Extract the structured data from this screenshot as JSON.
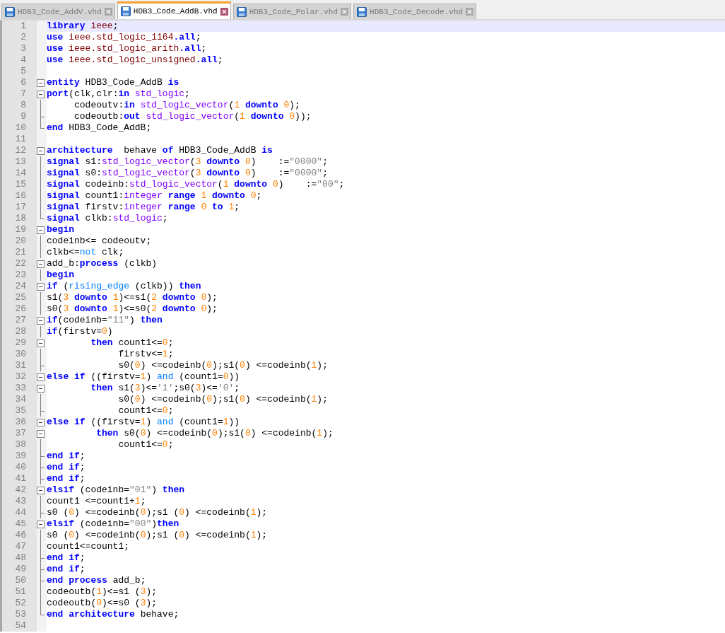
{
  "tabs": [
    {
      "label": "HDB3_Code_AddV.vhd",
      "selected": false
    },
    {
      "label": "HDB3_Code_AddB.vhd",
      "selected": true
    },
    {
      "label": "HDB3_Code_Polar.vhd",
      "selected": false
    },
    {
      "label": "HDB3_Code_Decode.vhd",
      "selected": false
    }
  ],
  "lines": [
    {
      "number": "1",
      "selected": true,
      "segments": [
        {
          "kind": "keyword",
          "text": "library"
        },
        {
          "kind": "library",
          "text": " ieee"
        },
        {
          "kind": "plain",
          "text": ";"
        }
      ]
    },
    {
      "number": "2",
      "selected": false,
      "segments": [
        {
          "kind": "keyword",
          "text": "use"
        },
        {
          "kind": "library",
          "text": " ieee.std_logic_1164"
        },
        {
          "kind": "keyword",
          "text": ".all"
        },
        {
          "kind": "plain",
          "text": ";"
        }
      ]
    },
    {
      "number": "3",
      "selected": false,
      "segments": [
        {
          "kind": "keyword",
          "text": "use"
        },
        {
          "kind": "library",
          "text": " ieee.std_logic_arith"
        },
        {
          "kind": "keyword",
          "text": ".all"
        },
        {
          "kind": "plain",
          "text": ";"
        }
      ]
    },
    {
      "number": "4",
      "selected": false,
      "segments": [
        {
          "kind": "keyword",
          "text": "use"
        },
        {
          "kind": "library",
          "text": " ieee.std_logic_unsigned"
        },
        {
          "kind": "keyword",
          "text": ".all"
        },
        {
          "kind": "plain",
          "text": ";"
        }
      ]
    },
    {
      "number": "5",
      "selected": false
    },
    {
      "number": "6",
      "selected": false,
      "kind": "start",
      "segments": [
        {
          "kind": "keyword",
          "text": "entity"
        },
        {
          "kind": "plain",
          "text": " HDB3_Code_AddB "
        },
        {
          "kind": "keyword",
          "text": "is"
        }
      ]
    },
    {
      "number": "7",
      "selected": false,
      "kind": "start",
      "segments": [
        {
          "kind": "keyword",
          "text": "port"
        },
        {
          "kind": "plain",
          "text": "(clk,clr:"
        },
        {
          "kind": "keyword",
          "text": "in"
        },
        {
          "kind": "type",
          "text": " std_logic"
        },
        {
          "kind": "plain",
          "text": ";"
        }
      ]
    },
    {
      "number": "8",
      "selected": false,
      "kind": "body",
      "segments": [
        {
          "kind": "plain",
          "text": "     codeoutv:"
        },
        {
          "kind": "keyword",
          "text": "in"
        },
        {
          "kind": "type",
          "text": " std_logic_vector"
        },
        {
          "kind": "plain",
          "text": "("
        },
        {
          "kind": "number",
          "text": "1"
        },
        {
          "kind": "keyword",
          "text": " downto"
        },
        {
          "kind": "number",
          "text": " 0"
        },
        {
          "kind": "plain",
          "text": ");"
        }
      ]
    },
    {
      "number": "9",
      "selected": false,
      "kind": "branch",
      "segments": [
        {
          "kind": "plain",
          "text": "     codeoutb:"
        },
        {
          "kind": "keyword",
          "text": "out"
        },
        {
          "kind": "type",
          "text": " std_logic_vector"
        },
        {
          "kind": "plain",
          "text": "("
        },
        {
          "kind": "number",
          "text": "1"
        },
        {
          "kind": "keyword",
          "text": " downto"
        },
        {
          "kind": "number",
          "text": " 0"
        },
        {
          "kind": "plain",
          "text": "));"
        }
      ]
    },
    {
      "number": "10",
      "selected": false,
      "kind": "end",
      "segments": [
        {
          "kind": "keyword",
          "text": "end"
        },
        {
          "kind": "plain",
          "text": " HDB3_Code_AddB;"
        }
      ]
    },
    {
      "number": "11",
      "selected": false
    },
    {
      "number": "12",
      "selected": false,
      "kind": "start",
      "segments": [
        {
          "kind": "keyword",
          "text": "architecture"
        },
        {
          "kind": "plain",
          "text": "  behave "
        },
        {
          "kind": "keyword",
          "text": "of"
        },
        {
          "kind": "plain",
          "text": " HDB3_Code_AddB "
        },
        {
          "kind": "keyword",
          "text": "is"
        }
      ]
    },
    {
      "number": "13",
      "selected": false,
      "kind": "body",
      "segments": [
        {
          "kind": "keyword",
          "text": "signal"
        },
        {
          "kind": "plain",
          "text": " s1:"
        },
        {
          "kind": "type",
          "text": "std_logic_vector"
        },
        {
          "kind": "plain",
          "text": "("
        },
        {
          "kind": "number",
          "text": "3"
        },
        {
          "kind": "keyword",
          "text": " downto"
        },
        {
          "kind": "number",
          "text": " 0"
        },
        {
          "kind": "plain",
          "text": ")    :="
        },
        {
          "kind": "string",
          "text": "\"0000\""
        },
        {
          "kind": "plain",
          "text": ";"
        }
      ]
    },
    {
      "number": "14",
      "selected": false,
      "kind": "body",
      "segments": [
        {
          "kind": "keyword",
          "text": "signal"
        },
        {
          "kind": "plain",
          "text": " s0:"
        },
        {
          "kind": "type",
          "text": "std_logic_vector"
        },
        {
          "kind": "plain",
          "text": "("
        },
        {
          "kind": "number",
          "text": "3"
        },
        {
          "kind": "keyword",
          "text": " downto"
        },
        {
          "kind": "number",
          "text": " 0"
        },
        {
          "kind": "plain",
          "text": ")    :="
        },
        {
          "kind": "string",
          "text": "\"0000\""
        },
        {
          "kind": "plain",
          "text": ";"
        }
      ]
    },
    {
      "number": "15",
      "selected": false,
      "kind": "body",
      "segments": [
        {
          "kind": "keyword",
          "text": "signal"
        },
        {
          "kind": "plain",
          "text": " codeinb:"
        },
        {
          "kind": "type",
          "text": "std_logic_vector"
        },
        {
          "kind": "plain",
          "text": "("
        },
        {
          "kind": "number",
          "text": "1"
        },
        {
          "kind": "keyword",
          "text": " downto"
        },
        {
          "kind": "number",
          "text": " 0"
        },
        {
          "kind": "plain",
          "text": ")    :="
        },
        {
          "kind": "string",
          "text": "\"00\""
        },
        {
          "kind": "plain",
          "text": ";"
        }
      ]
    },
    {
      "number": "16",
      "selected": false,
      "kind": "body",
      "segments": [
        {
          "kind": "keyword",
          "text": "signal"
        },
        {
          "kind": "plain",
          "text": " count1:"
        },
        {
          "kind": "type",
          "text": "integer"
        },
        {
          "kind": "keyword",
          "text": " range"
        },
        {
          "kind": "number",
          "text": " 1"
        },
        {
          "kind": "keyword",
          "text": " downto"
        },
        {
          "kind": "number",
          "text": " 0"
        },
        {
          "kind": "plain",
          "text": ";"
        }
      ]
    },
    {
      "number": "17",
      "selected": false,
      "kind": "body",
      "segments": [
        {
          "kind": "keyword",
          "text": "signal"
        },
        {
          "kind": "plain",
          "text": " firstv:"
        },
        {
          "kind": "type",
          "text": "integer"
        },
        {
          "kind": "keyword",
          "text": " range"
        },
        {
          "kind": "number",
          "text": " 0"
        },
        {
          "kind": "keyword",
          "text": " to"
        },
        {
          "kind": "number",
          "text": " 1"
        },
        {
          "kind": "plain",
          "text": ";"
        }
      ]
    },
    {
      "number": "18",
      "selected": false,
      "kind": "end",
      "segments": [
        {
          "kind": "keyword",
          "text": "signal"
        },
        {
          "kind": "plain",
          "text": " clkb:"
        },
        {
          "kind": "type",
          "text": "std_logic"
        },
        {
          "kind": "plain",
          "text": ";"
        }
      ]
    },
    {
      "number": "19",
      "selected": false,
      "kind": "start",
      "segments": [
        {
          "kind": "keyword",
          "text": "begin"
        }
      ]
    },
    {
      "number": "20",
      "selected": false,
      "kind": "body",
      "segments": [
        {
          "kind": "plain",
          "text": "codeinb<= codeoutv;"
        }
      ]
    },
    {
      "number": "21",
      "selected": false,
      "kind": "body",
      "segments": [
        {
          "kind": "plain",
          "text": "clkb<="
        },
        {
          "kind": "operator",
          "text": "not"
        },
        {
          "kind": "plain",
          "text": " clk;"
        }
      ]
    },
    {
      "number": "22",
      "selected": false,
      "kind": "start",
      "segments": [
        {
          "kind": "plain",
          "text": "add_b:"
        },
        {
          "kind": "keyword",
          "text": "process"
        },
        {
          "kind": "plain",
          "text": " (clkb)"
        }
      ]
    },
    {
      "number": "23",
      "selected": false,
      "kind": "body",
      "segments": [
        {
          "kind": "keyword",
          "text": "begin"
        }
      ]
    },
    {
      "number": "24",
      "selected": false,
      "kind": "start",
      "segments": [
        {
          "kind": "keyword",
          "text": "if"
        },
        {
          "kind": "plain",
          "text": " ("
        },
        {
          "kind": "operator",
          "text": "rising_edge"
        },
        {
          "kind": "plain",
          "text": " (clkb)) "
        },
        {
          "kind": "keyword",
          "text": "then"
        }
      ]
    },
    {
      "number": "25",
      "selected": false,
      "kind": "body",
      "segments": [
        {
          "kind": "plain",
          "text": "s1("
        },
        {
          "kind": "number",
          "text": "3"
        },
        {
          "kind": "keyword",
          "text": " downto"
        },
        {
          "kind": "number",
          "text": " 1"
        },
        {
          "kind": "plain",
          "text": ")<=s1("
        },
        {
          "kind": "number",
          "text": "2"
        },
        {
          "kind": "keyword",
          "text": " downto"
        },
        {
          "kind": "number",
          "text": " 0"
        },
        {
          "kind": "plain",
          "text": ");"
        }
      ]
    },
    {
      "number": "26",
      "selected": false,
      "kind": "body",
      "segments": [
        {
          "kind": "plain",
          "text": "s0("
        },
        {
          "kind": "number",
          "text": "3"
        },
        {
          "kind": "keyword",
          "text": " downto"
        },
        {
          "kind": "number",
          "text": " 1"
        },
        {
          "kind": "plain",
          "text": ")<=s0("
        },
        {
          "kind": "number",
          "text": "2"
        },
        {
          "kind": "keyword",
          "text": " downto"
        },
        {
          "kind": "number",
          "text": " 0"
        },
        {
          "kind": "plain",
          "text": ");"
        }
      ]
    },
    {
      "number": "27",
      "selected": false,
      "kind": "start",
      "segments": [
        {
          "kind": "keyword",
          "text": "if"
        },
        {
          "kind": "plain",
          "text": "(codeinb="
        },
        {
          "kind": "string",
          "text": "\"11\""
        },
        {
          "kind": "plain",
          "text": ") "
        },
        {
          "kind": "keyword",
          "text": "then"
        }
      ]
    },
    {
      "number": "28",
      "selected": false,
      "kind": "body",
      "segments": [
        {
          "kind": "keyword",
          "text": "if"
        },
        {
          "kind": "plain",
          "text": "(firstv="
        },
        {
          "kind": "number",
          "text": "0"
        },
        {
          "kind": "plain",
          "text": ")"
        }
      ]
    },
    {
      "number": "29",
      "selected": false,
      "kind": "start",
      "segments": [
        {
          "kind": "keyword",
          "text": "        then"
        },
        {
          "kind": "plain",
          "text": " count1<="
        },
        {
          "kind": "number",
          "text": "0"
        },
        {
          "kind": "plain",
          "text": ";"
        }
      ]
    },
    {
      "number": "30",
      "selected": false,
      "kind": "body",
      "segments": [
        {
          "kind": "plain",
          "text": "             firstv<="
        },
        {
          "kind": "number",
          "text": "1"
        },
        {
          "kind": "plain",
          "text": ";"
        }
      ]
    },
    {
      "number": "31",
      "selected": false,
      "kind": "branch",
      "segments": [
        {
          "kind": "plain",
          "text": "             s0("
        },
        {
          "kind": "number",
          "text": "0"
        },
        {
          "kind": "plain",
          "text": ") <=codeinb("
        },
        {
          "kind": "number",
          "text": "0"
        },
        {
          "kind": "plain",
          "text": ");s1("
        },
        {
          "kind": "number",
          "text": "0"
        },
        {
          "kind": "plain",
          "text": ") <=codeinb("
        },
        {
          "kind": "number",
          "text": "1"
        },
        {
          "kind": "plain",
          "text": ");"
        }
      ]
    },
    {
      "number": "32",
      "selected": false,
      "kind": "start",
      "segments": [
        {
          "kind": "keyword",
          "text": "else"
        },
        {
          "kind": "keyword",
          "text": " if"
        },
        {
          "kind": "plain",
          "text": " ((firstv="
        },
        {
          "kind": "number",
          "text": "1"
        },
        {
          "kind": "plain",
          "text": ") "
        },
        {
          "kind": "operator",
          "text": "and"
        },
        {
          "kind": "plain",
          "text": " (count1="
        },
        {
          "kind": "number",
          "text": "0"
        },
        {
          "kind": "plain",
          "text": "))"
        }
      ]
    },
    {
      "number": "33",
      "selected": false,
      "kind": "start",
      "segments": [
        {
          "kind": "keyword",
          "text": "        then"
        },
        {
          "kind": "plain",
          "text": " s1("
        },
        {
          "kind": "number",
          "text": "3"
        },
        {
          "kind": "plain",
          "text": ")<="
        },
        {
          "kind": "string",
          "text": "'1'"
        },
        {
          "kind": "plain",
          "text": ";s0("
        },
        {
          "kind": "number",
          "text": "3"
        },
        {
          "kind": "plain",
          "text": ")<="
        },
        {
          "kind": "string",
          "text": "'0'"
        },
        {
          "kind": "plain",
          "text": ";"
        }
      ]
    },
    {
      "number": "34",
      "selected": false,
      "kind": "body",
      "segments": [
        {
          "kind": "plain",
          "text": "             s0("
        },
        {
          "kind": "number",
          "text": "0"
        },
        {
          "kind": "plain",
          "text": ") <=codeinb("
        },
        {
          "kind": "number",
          "text": "0"
        },
        {
          "kind": "plain",
          "text": ");s1("
        },
        {
          "kind": "number",
          "text": "0"
        },
        {
          "kind": "plain",
          "text": ") <=codeinb("
        },
        {
          "kind": "number",
          "text": "1"
        },
        {
          "kind": "plain",
          "text": ");"
        }
      ]
    },
    {
      "number": "35",
      "selected": false,
      "kind": "branch",
      "segments": [
        {
          "kind": "plain",
          "text": "             count1<="
        },
        {
          "kind": "number",
          "text": "0"
        },
        {
          "kind": "plain",
          "text": ";"
        }
      ]
    },
    {
      "number": "36",
      "selected": false,
      "kind": "start",
      "segments": [
        {
          "kind": "keyword",
          "text": "else"
        },
        {
          "kind": "keyword",
          "text": " if"
        },
        {
          "kind": "plain",
          "text": " ((firstv="
        },
        {
          "kind": "number",
          "text": "1"
        },
        {
          "kind": "plain",
          "text": ") "
        },
        {
          "kind": "operator",
          "text": "and"
        },
        {
          "kind": "plain",
          "text": " (count1="
        },
        {
          "kind": "number",
          "text": "1"
        },
        {
          "kind": "plain",
          "text": "))"
        }
      ]
    },
    {
      "number": "37",
      "selected": false,
      "kind": "start",
      "segments": [
        {
          "kind": "keyword",
          "text": "         then"
        },
        {
          "kind": "plain",
          "text": " s0("
        },
        {
          "kind": "number",
          "text": "0"
        },
        {
          "kind": "plain",
          "text": ") <=codeinb("
        },
        {
          "kind": "number",
          "text": "0"
        },
        {
          "kind": "plain",
          "text": ");s1("
        },
        {
          "kind": "number",
          "text": "0"
        },
        {
          "kind": "plain",
          "text": ") <=codeinb("
        },
        {
          "kind": "number",
          "text": "1"
        },
        {
          "kind": "plain",
          "text": ");"
        }
      ]
    },
    {
      "number": "38",
      "selected": false,
      "kind": "body",
      "segments": [
        {
          "kind": "plain",
          "text": "             count1<="
        },
        {
          "kind": "number",
          "text": "0"
        },
        {
          "kind": "plain",
          "text": ";"
        }
      ]
    },
    {
      "number": "39",
      "selected": false,
      "kind": "branch",
      "segments": [
        {
          "kind": "keyword",
          "text": "end"
        },
        {
          "kind": "keyword",
          "text": " if"
        },
        {
          "kind": "plain",
          "text": ";"
        }
      ]
    },
    {
      "number": "40",
      "selected": false,
      "kind": "branch",
      "segments": [
        {
          "kind": "keyword",
          "text": "end"
        },
        {
          "kind": "keyword",
          "text": " if"
        },
        {
          "kind": "plain",
          "text": ";"
        }
      ]
    },
    {
      "number": "41",
      "selected": false,
      "kind": "branch",
      "segments": [
        {
          "kind": "keyword",
          "text": "end"
        },
        {
          "kind": "keyword",
          "text": " if"
        },
        {
          "kind": "plain",
          "text": ";"
        }
      ]
    },
    {
      "number": "42",
      "selected": false,
      "kind": "start",
      "segments": [
        {
          "kind": "keyword",
          "text": "elsif"
        },
        {
          "kind": "plain",
          "text": " (codeinb="
        },
        {
          "kind": "string",
          "text": "\"01\""
        },
        {
          "kind": "plain",
          "text": ") "
        },
        {
          "kind": "keyword",
          "text": "then"
        }
      ]
    },
    {
      "number": "43",
      "selected": false,
      "kind": "body",
      "segments": [
        {
          "kind": "plain",
          "text": "count1 <=count1+"
        },
        {
          "kind": "number",
          "text": "1"
        },
        {
          "kind": "plain",
          "text": ";"
        }
      ]
    },
    {
      "number": "44",
      "selected": false,
      "kind": "branch",
      "segments": [
        {
          "kind": "plain",
          "text": "s0 ("
        },
        {
          "kind": "number",
          "text": "0"
        },
        {
          "kind": "plain",
          "text": ") <=codeinb("
        },
        {
          "kind": "number",
          "text": "0"
        },
        {
          "kind": "plain",
          "text": ");s1 ("
        },
        {
          "kind": "number",
          "text": "0"
        },
        {
          "kind": "plain",
          "text": ") <=codeinb("
        },
        {
          "kind": "number",
          "text": "1"
        },
        {
          "kind": "plain",
          "text": ");"
        }
      ]
    },
    {
      "number": "45",
      "selected": false,
      "kind": "start",
      "segments": [
        {
          "kind": "keyword",
          "text": "elsif"
        },
        {
          "kind": "plain",
          "text": " (codeinb="
        },
        {
          "kind": "string",
          "text": "\"00\""
        },
        {
          "kind": "plain",
          "text": ")"
        },
        {
          "kind": "keyword",
          "text": "then"
        }
      ]
    },
    {
      "number": "46",
      "selected": false,
      "kind": "body",
      "segments": [
        {
          "kind": "plain",
          "text": "s0 ("
        },
        {
          "kind": "number",
          "text": "0"
        },
        {
          "kind": "plain",
          "text": ") <=codeinb("
        },
        {
          "kind": "number",
          "text": "0"
        },
        {
          "kind": "plain",
          "text": ");s1 ("
        },
        {
          "kind": "number",
          "text": "0"
        },
        {
          "kind": "plain",
          "text": ") <=codeinb("
        },
        {
          "kind": "number",
          "text": "1"
        },
        {
          "kind": "plain",
          "text": ");"
        }
      ]
    },
    {
      "number": "47",
      "selected": false,
      "kind": "body",
      "segments": [
        {
          "kind": "plain",
          "text": "count1<=count1;"
        }
      ]
    },
    {
      "number": "48",
      "selected": false,
      "kind": "branch",
      "segments": [
        {
          "kind": "keyword",
          "text": "end"
        },
        {
          "kind": "keyword",
          "text": " if"
        },
        {
          "kind": "plain",
          "text": ";"
        }
      ]
    },
    {
      "number": "49",
      "selected": false,
      "kind": "branch",
      "segments": [
        {
          "kind": "keyword",
          "text": "end"
        },
        {
          "kind": "keyword",
          "text": " if"
        },
        {
          "kind": "plain",
          "text": ";"
        }
      ]
    },
    {
      "number": "50",
      "selected": false,
      "kind": "branch",
      "segments": [
        {
          "kind": "keyword",
          "text": "end"
        },
        {
          "kind": "keyword",
          "text": " process"
        },
        {
          "kind": "plain",
          "text": " add_b;"
        }
      ]
    },
    {
      "number": "51",
      "selected": false,
      "kind": "body",
      "segments": [
        {
          "kind": "plain",
          "text": "codeoutb("
        },
        {
          "kind": "number",
          "text": "1"
        },
        {
          "kind": "plain",
          "text": ")<=s1 ("
        },
        {
          "kind": "number",
          "text": "3"
        },
        {
          "kind": "plain",
          "text": ");"
        }
      ]
    },
    {
      "number": "52",
      "selected": false,
      "kind": "body",
      "segments": [
        {
          "kind": "plain",
          "text": "codeoutb("
        },
        {
          "kind": "number",
          "text": "0"
        },
        {
          "kind": "plain",
          "text": ")<=s0 ("
        },
        {
          "kind": "number",
          "text": "3"
        },
        {
          "kind": "plain",
          "text": ");"
        }
      ]
    },
    {
      "number": "53",
      "selected": false,
      "kind": "end",
      "segments": [
        {
          "kind": "keyword",
          "text": "end"
        },
        {
          "kind": "keyword",
          "text": " architecture"
        },
        {
          "kind": "plain",
          "text": " behave;"
        }
      ]
    },
    {
      "number": "54",
      "selected": false
    }
  ]
}
